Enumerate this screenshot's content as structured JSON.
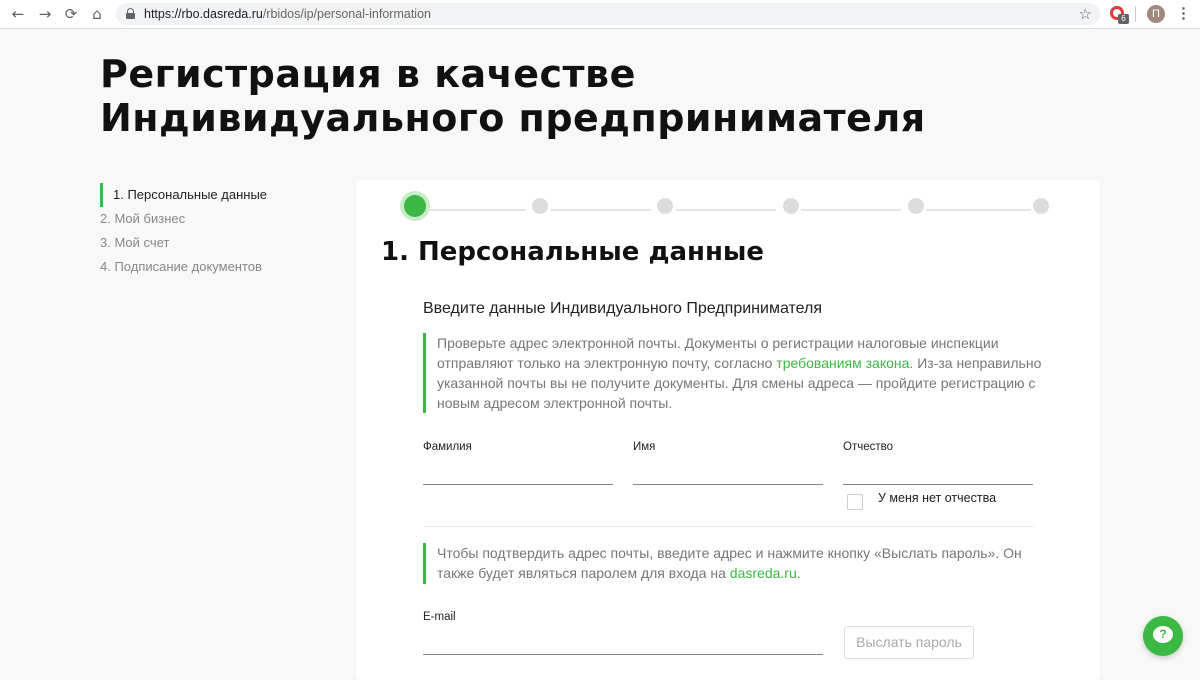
{
  "browser": {
    "back_icon": "←",
    "forward_icon": "→",
    "reload_icon": "⟳",
    "home_icon": "⌂",
    "url_prefix": "https://rbo.dasreda.ru",
    "url_path": "/rbidos/ip/personal-information",
    "star_icon": "☆",
    "extension_badge": "6",
    "avatar_letter": "П",
    "menu_icon": "⋮"
  },
  "page": {
    "title_line1": "Регистрация в качестве",
    "title_line2": "Индивидуального предпринимателя"
  },
  "steps_nav": [
    {
      "label": "1.  Персональные данные",
      "active": true
    },
    {
      "label": "2. Мой бизнес",
      "active": false
    },
    {
      "label": "3. Мой счет",
      "active": false
    },
    {
      "label": "4. Подписание документов",
      "active": false
    }
  ],
  "progress": {
    "total_steps": 6,
    "current_step": 1
  },
  "form": {
    "section_title": "1.  Персональные данные",
    "subtitle": "Введите данные Индивидуального Предпринимателя",
    "notice1": {
      "text_before": "Проверьте адрес электронной почты. Документы о регистрации налоговые инспекции отправляют только на электронную почту, согласно ",
      "link": "требованиям закона.",
      "text_after": " Из-за неправильно указанной почты вы не получите документы. Для смены адреса — пройдите регистрацию с новым адресом электронной почты."
    },
    "surname_label": "Фамилия",
    "name_label": "Имя",
    "patronymic_label": "Отчество",
    "no_patronymic_label": "У меня нет отчества",
    "notice2": {
      "text_before": "Чтобы подтвердить адрес почты, введите адрес и нажмите кнопку «Выслать пароль». Он также будет являться паролем для входа на ",
      "link": "dasreda.ru."
    },
    "email_label": "E-mail",
    "send_password_button": "Выслать пароль"
  },
  "chat": {
    "icon_glyph": "?"
  },
  "colors": {
    "accent": "#3cb944",
    "muted": "#777777"
  }
}
